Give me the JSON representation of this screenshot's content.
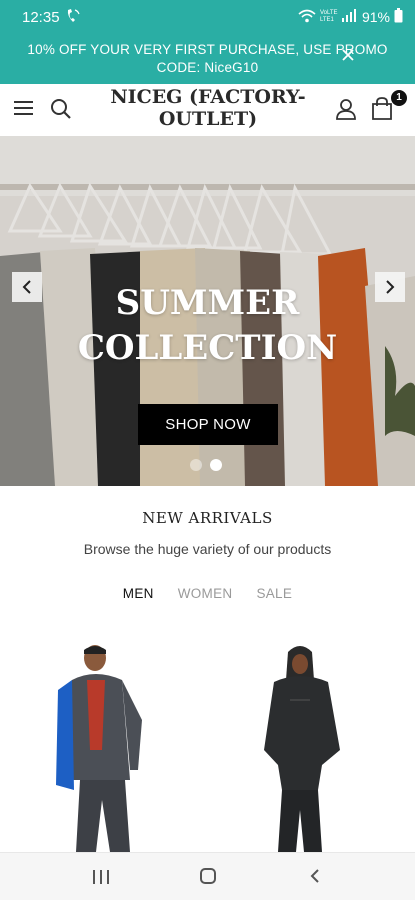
{
  "status": {
    "time": "12:35",
    "battery": "91%",
    "network": "VoLTE LTE1"
  },
  "promo": {
    "text": "10% OFF YOUR VERY FIRST PURCHASE, USE PROMO CODE: NiceG10"
  },
  "header": {
    "title": "NICEG (FACTORY-OUTLET)",
    "cart_count": "1"
  },
  "hero": {
    "title": "SUMMER COLLECTION",
    "button": "SHOP NOW",
    "slides": 2,
    "active_slide": 2
  },
  "arrivals": {
    "title": "NEW ARRIVALS",
    "subtitle": "Browse the huge variety of our products",
    "tabs": [
      {
        "label": "MEN",
        "active": true
      },
      {
        "label": "WOMEN",
        "active": false
      },
      {
        "label": "SALE",
        "active": false
      }
    ]
  },
  "colors": {
    "accent": "#2aaea4",
    "button": "#000000"
  }
}
